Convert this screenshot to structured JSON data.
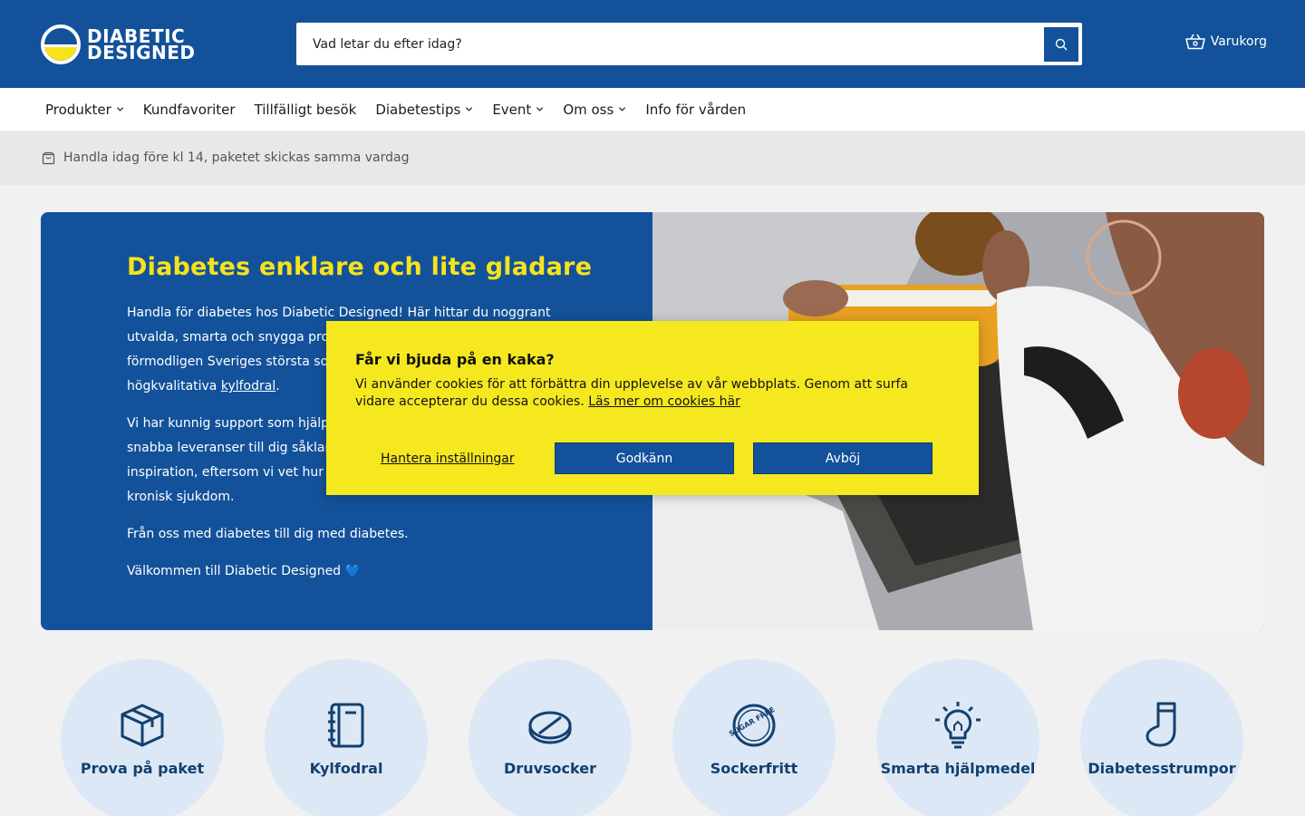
{
  "header": {
    "logo_line1": "DIABETIC",
    "logo_line2": "DESIGNED",
    "search_placeholder": "Vad letar du efter idag?",
    "cart_label": "Varukorg"
  },
  "nav": [
    {
      "label": "Produkter",
      "dropdown": true
    },
    {
      "label": "Kundfavoriter",
      "dropdown": false
    },
    {
      "label": "Tillfälligt besök",
      "dropdown": false
    },
    {
      "label": "Diabetestips",
      "dropdown": true
    },
    {
      "label": "Event",
      "dropdown": true
    },
    {
      "label": "Om oss",
      "dropdown": true
    },
    {
      "label": "Info för vården",
      "dropdown": false
    }
  ],
  "info_strip": {
    "text": "Handla idag före kl 14, paketet skickas samma vardag"
  },
  "hero": {
    "title": "Diabetes enklare och lite gladare",
    "p1_before": "Handla för diabetes hos Diabetic Designed! Här hittar du noggrant utvalda, smarta och snygga produkter för diabetes. Vi har förmodligen Sveriges största sortiment av diabetesväskor och högkvalitativa ",
    "p1_link": "kylfodral",
    "p1_after": ".",
    "p2": "Vi har kunnig support som hjälper dig med val av produkter och snabba leveranser till dig såklart. Vi vill ge dig en gnutta inspiration, eftersom vi vet hur viktigt det är att leva med en kronisk sjukdom.",
    "p3": "Från oss med diabetes till dig med diabetes.",
    "p4": "Välkommen till Diabetic Designed 💙"
  },
  "cookie": {
    "title": "Får vi bjuda på en kaka?",
    "text": "Vi använder cookies för att förbättra din upplevelse av vår webbplats. Genom att surfa vidare accepterar du dessa cookies. ",
    "link": "Läs mer om cookies här",
    "manage": "Hantera inställningar",
    "accept": "Godkänn",
    "decline": "Avböj"
  },
  "categories": [
    {
      "label": "Prova på paket",
      "icon": "box-icon"
    },
    {
      "label": "Kylfodral",
      "icon": "notebook-icon"
    },
    {
      "label": "Druvsocker",
      "icon": "tablet-icon"
    },
    {
      "label": "Sockerfritt",
      "icon": "sugar-free-icon",
      "badge_text": "SUGAR FREE"
    },
    {
      "label": "Smarta hjälpmedel",
      "icon": "lightbulb-icon"
    },
    {
      "label": "Diabetesstrumpor",
      "icon": "sock-icon"
    }
  ],
  "colors": {
    "brand_blue": "#13529a",
    "brand_yellow": "#f6e31b",
    "category_bg": "#dce8f5"
  }
}
